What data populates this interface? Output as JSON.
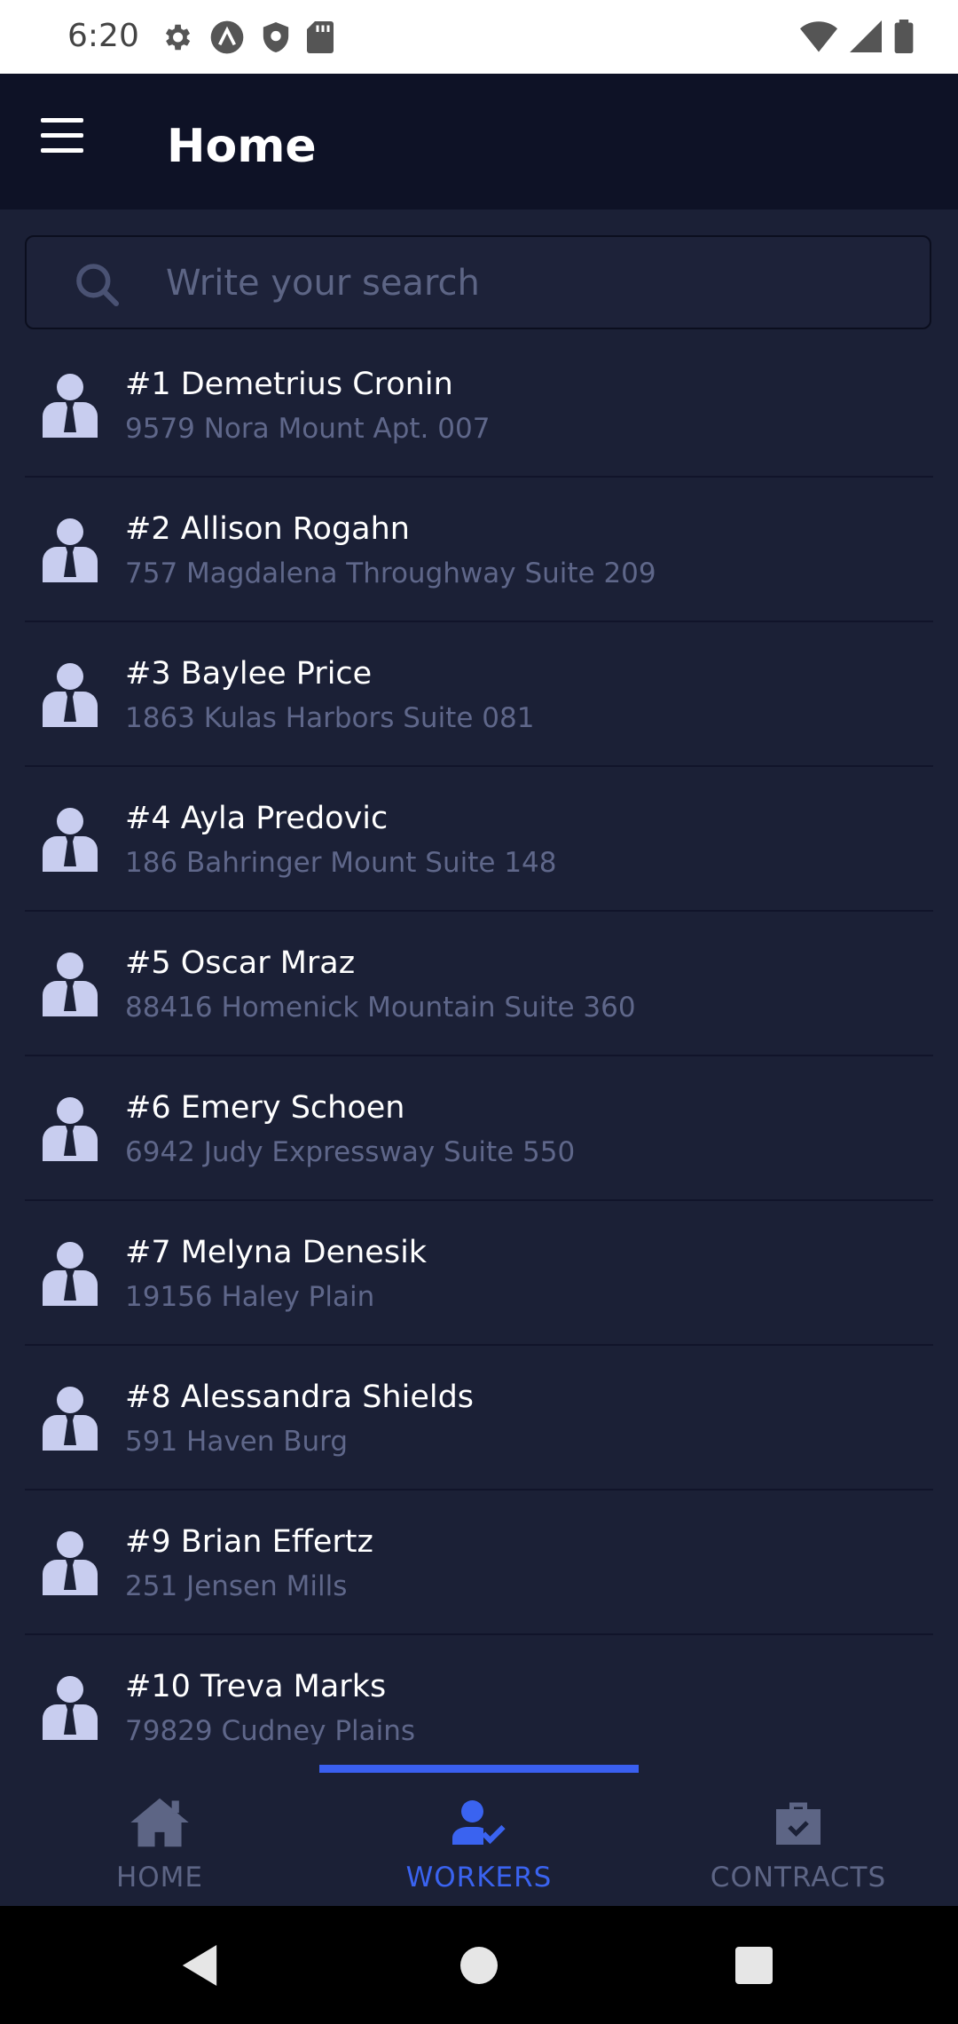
{
  "status_bar": {
    "time": "6:20",
    "left_icons": [
      "gear-icon",
      "a-icon",
      "shield-icon",
      "sd-card-icon"
    ],
    "right_icons": [
      "wifi-icon",
      "signal-icon",
      "battery-icon"
    ]
  },
  "app_bar": {
    "title": "Home",
    "menu_icon": "hamburger-menu-icon"
  },
  "search": {
    "placeholder": "Write your search",
    "value": "",
    "icon": "search-icon"
  },
  "workers": [
    {
      "name": "#1 Demetrius Cronin",
      "address": "9579 Nora Mount Apt. 007"
    },
    {
      "name": "#2 Allison Rogahn",
      "address": "757 Magdalena Throughway Suite 209"
    },
    {
      "name": "#3 Baylee Price",
      "address": "1863 Kulas Harbors Suite 081"
    },
    {
      "name": "#4 Ayla Predovic",
      "address": "186 Bahringer Mount Suite 148"
    },
    {
      "name": "#5 Oscar Mraz",
      "address": "88416 Homenick Mountain Suite 360"
    },
    {
      "name": "#6 Emery Schoen",
      "address": "6942 Judy Expressway Suite 550"
    },
    {
      "name": "#7 Melyna Denesik",
      "address": "19156 Haley Plain"
    },
    {
      "name": "#8 Alessandra Shields",
      "address": "591 Haven Burg"
    },
    {
      "name": "#9 Brian Effertz",
      "address": "251 Jensen Mills"
    },
    {
      "name": "#10 Treva Marks",
      "address": "79829 Cudney Plains"
    }
  ],
  "bottom_nav": {
    "items": [
      {
        "label": "HOME",
        "icon": "home-icon",
        "active": false
      },
      {
        "label": "WORKERS",
        "icon": "user-check-icon",
        "active": true
      },
      {
        "label": "CONTRACTS",
        "icon": "briefcase-check-icon",
        "active": false
      }
    ]
  },
  "colors": {
    "background": "#1b2036",
    "app_bar": "#0e1226",
    "accent": "#3a5ff0",
    "muted_text": "#5d6585",
    "worker_icon": "#c8cdef"
  }
}
